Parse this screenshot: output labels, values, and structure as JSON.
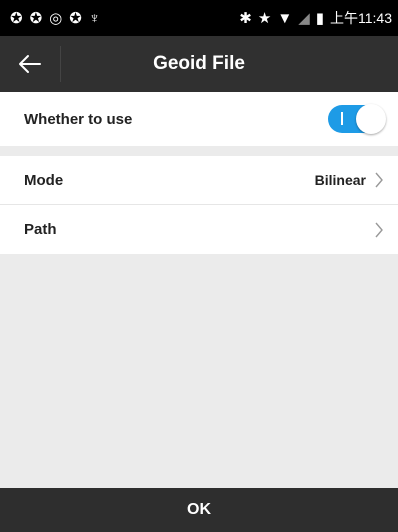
{
  "status_bar": {
    "time": "上午11:43",
    "icons_left": [
      "sync-icon",
      "sync-icon",
      "camera-icon",
      "sync-icon",
      "usb-icon"
    ],
    "icons_right": [
      "bluetooth-icon",
      "star-icon",
      "wifi-icon",
      "signal-icon",
      "battery-icon"
    ]
  },
  "app_bar": {
    "title": "Geoid File",
    "back_icon": "back-arrow-icon"
  },
  "settings": {
    "use": {
      "label": "Whether to use",
      "enabled": true
    },
    "mode": {
      "label": "Mode",
      "value": "Bilinear"
    },
    "path": {
      "label": "Path",
      "value": ""
    }
  },
  "footer": {
    "ok_label": "OK"
  },
  "colors": {
    "toggle_on": "#1e9be6",
    "app_bar": "#303030",
    "footer": "#2e2e2e",
    "background": "#ebebeb"
  }
}
